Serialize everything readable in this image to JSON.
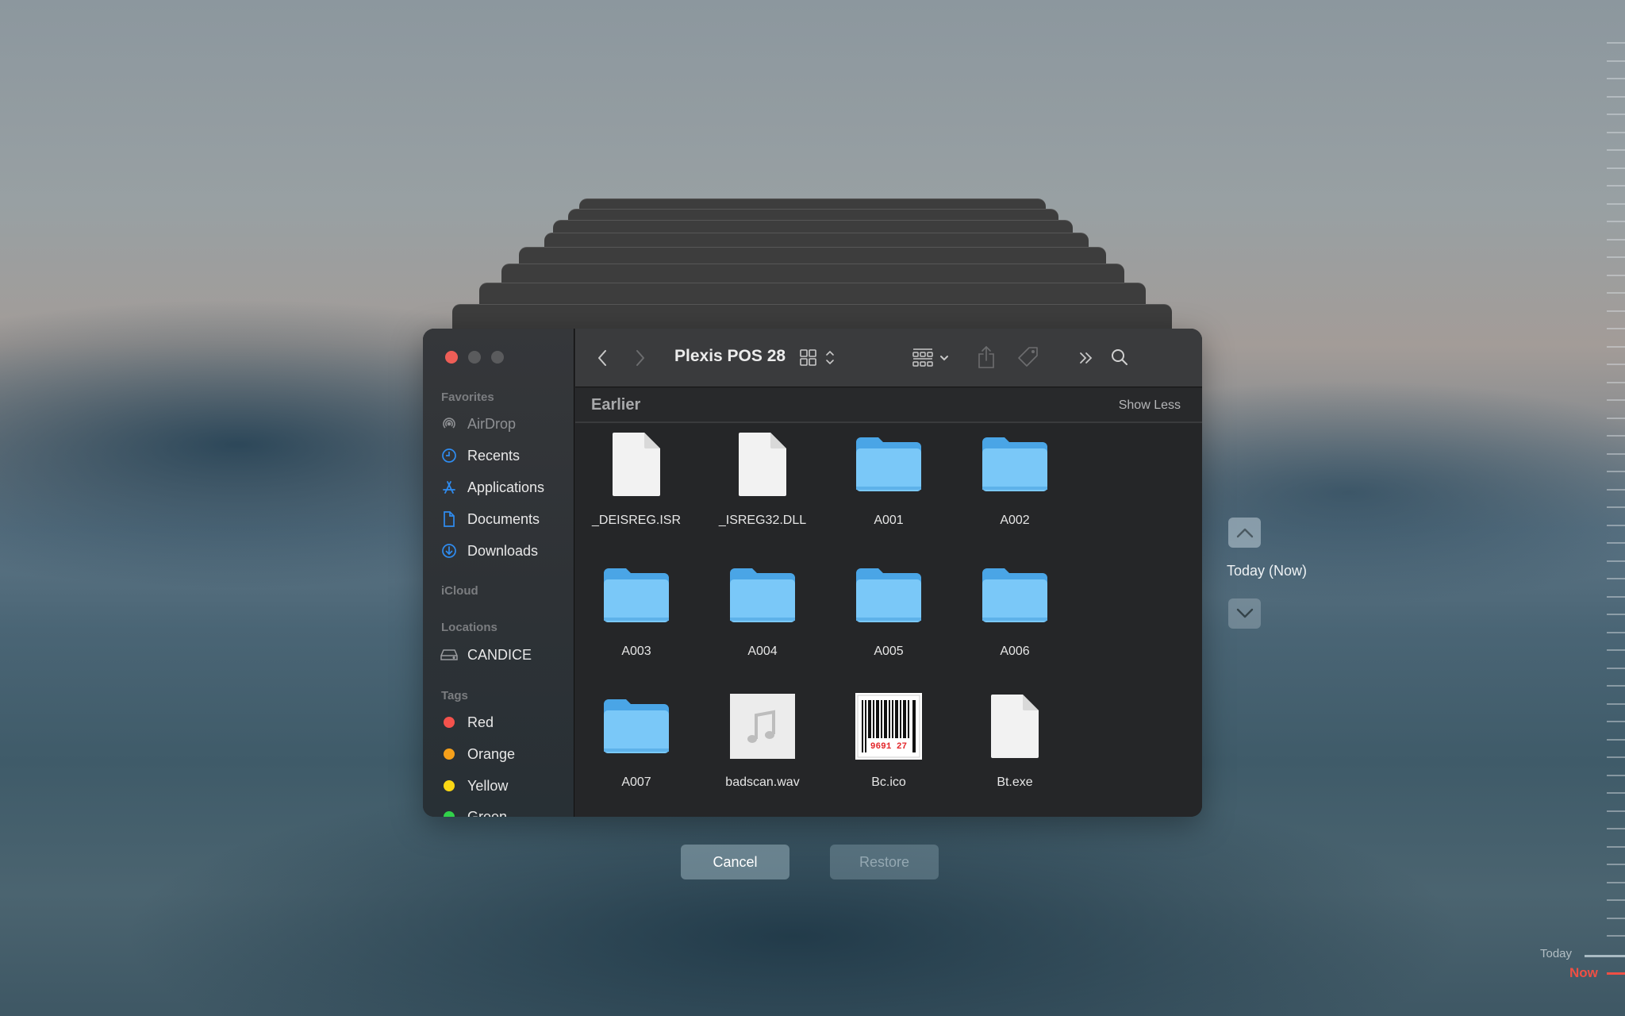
{
  "window": {
    "title": "Plexis POS 28"
  },
  "sidebar": {
    "sections": {
      "favorites": "Favorites",
      "icloud": "iCloud",
      "locations": "Locations",
      "tags": "Tags"
    },
    "favorites": [
      {
        "label": "AirDrop",
        "icon": "airdrop-icon",
        "dimmed": true
      },
      {
        "label": "Recents",
        "icon": "clock-icon"
      },
      {
        "label": "Applications",
        "icon": "applications-icon"
      },
      {
        "label": "Documents",
        "icon": "document-icon"
      },
      {
        "label": "Downloads",
        "icon": "download-icon"
      }
    ],
    "locations": [
      {
        "label": "CANDICE",
        "icon": "disk-icon"
      }
    ],
    "tags": [
      {
        "label": "Red",
        "color": "#f4524c"
      },
      {
        "label": "Orange",
        "color": "#f6a01a"
      },
      {
        "label": "Yellow",
        "color": "#fad714"
      },
      {
        "label": "Green",
        "color": "#31d14a"
      }
    ]
  },
  "toolbar": {
    "back": "chevron-left-icon",
    "forward": "chevron-right-icon",
    "view_mode": "icon-view-icon",
    "group": "group-by-icon",
    "share": "share-icon",
    "tag": "tag-icon",
    "more": "double-chevron-icon",
    "search": "search-icon"
  },
  "content": {
    "section_label": "Earlier",
    "toggle_label": "Show Less",
    "items": [
      {
        "name": "_DEISREG.ISR",
        "type": "document"
      },
      {
        "name": "_ISREG32.DLL",
        "type": "document"
      },
      {
        "name": "A001",
        "type": "folder"
      },
      {
        "name": "A002",
        "type": "folder"
      },
      {
        "name": "A003",
        "type": "folder"
      },
      {
        "name": "A004",
        "type": "folder"
      },
      {
        "name": "A005",
        "type": "folder"
      },
      {
        "name": "A006",
        "type": "folder"
      },
      {
        "name": "A007",
        "type": "folder"
      },
      {
        "name": "badscan.wav",
        "type": "audio"
      },
      {
        "name": "Bc.ico",
        "type": "barcode",
        "barcode_digits": "9691 27"
      },
      {
        "name": "Bt.exe",
        "type": "document"
      }
    ]
  },
  "actions": {
    "cancel": "Cancel",
    "restore": "Restore"
  },
  "time_machine": {
    "current_snapshot": "Today (Now)",
    "timeline_today": "Today",
    "timeline_now": "Now",
    "accent_now": "#ef4f44"
  }
}
